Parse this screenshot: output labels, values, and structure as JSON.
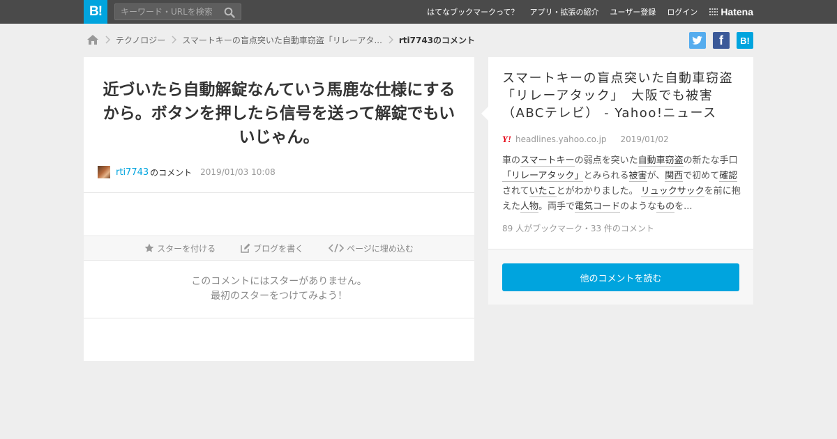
{
  "header": {
    "logo_text": "B!",
    "search_placeholder": "キーワード・URLを検索",
    "nav": [
      "はてなブックマークって？",
      "アプリ・拡張の紹介",
      "ユーザー登録",
      "ログイン"
    ],
    "brand": "Hatena"
  },
  "breadcrumb": {
    "items": [
      "テクノロジー",
      "スマートキーの盲点突いた自動車窃盗「リレーアタ..."
    ],
    "current": "rti7743のコメント"
  },
  "share": {
    "facebook_label": "f",
    "hatena_label": "B!"
  },
  "comment": {
    "text": "近づいたら自動解錠なんていう馬鹿な仕様にするから。ボタンを押したら信号を送って解錠でもいいじゃん。",
    "author": "rti7743",
    "author_suffix": "のコメント",
    "date": "2019/01/03 10:08"
  },
  "actions": {
    "star": "スターを付ける",
    "blog": "ブログを書く",
    "embed": "ページに埋め込む"
  },
  "nostar": {
    "line1": "このコメントにはスターがありません。",
    "line2": "最初のスターをつけてみよう！"
  },
  "entry": {
    "title": "スマートキーの盲点突いた自動車窃盗「リレーアタック」　大阪でも被害（ABCテレビ） - Yahoo!ニュース",
    "source_icon": "Y!",
    "domain": "headlines.yahoo.co.jp",
    "date": "2019/01/02",
    "summary": [
      {
        "t": "車の",
        "k": false
      },
      {
        "t": "スマートキー",
        "k": true
      },
      {
        "t": "の弱点を突いた",
        "k": false
      },
      {
        "t": "自動車窃盗",
        "k": true
      },
      {
        "t": "の新たな手口",
        "k": false
      },
      {
        "t": "「リレーアタック」",
        "k": true
      },
      {
        "t": "とみられる",
        "k": false
      },
      {
        "t": "被害",
        "k": true
      },
      {
        "t": "が、",
        "k": false
      },
      {
        "t": "関西",
        "k": true
      },
      {
        "t": "で初めて",
        "k": false
      },
      {
        "t": "確認",
        "k": true
      },
      {
        "t": "されて",
        "k": false
      },
      {
        "t": "いたこ",
        "k": true
      },
      {
        "t": "とがわかりました。 ",
        "k": false
      },
      {
        "t": "リュックサック",
        "k": true
      },
      {
        "t": "を前に抱えた",
        "k": false
      },
      {
        "t": "人物",
        "k": true
      },
      {
        "t": "。両手で",
        "k": false
      },
      {
        "t": "電気コード",
        "k": true
      },
      {
        "t": "のような",
        "k": false
      },
      {
        "t": "もの",
        "k": true
      },
      {
        "t": "を...",
        "k": false
      }
    ],
    "counts": "89 人がブックマーク・33 件のコメント",
    "read_more": "他のコメントを読む"
  },
  "colors": {
    "accent": "#00a4de",
    "topbar": "#4a4a4a",
    "twitter": "#55acee",
    "facebook": "#3b5998",
    "yahoo": "#e60012"
  }
}
